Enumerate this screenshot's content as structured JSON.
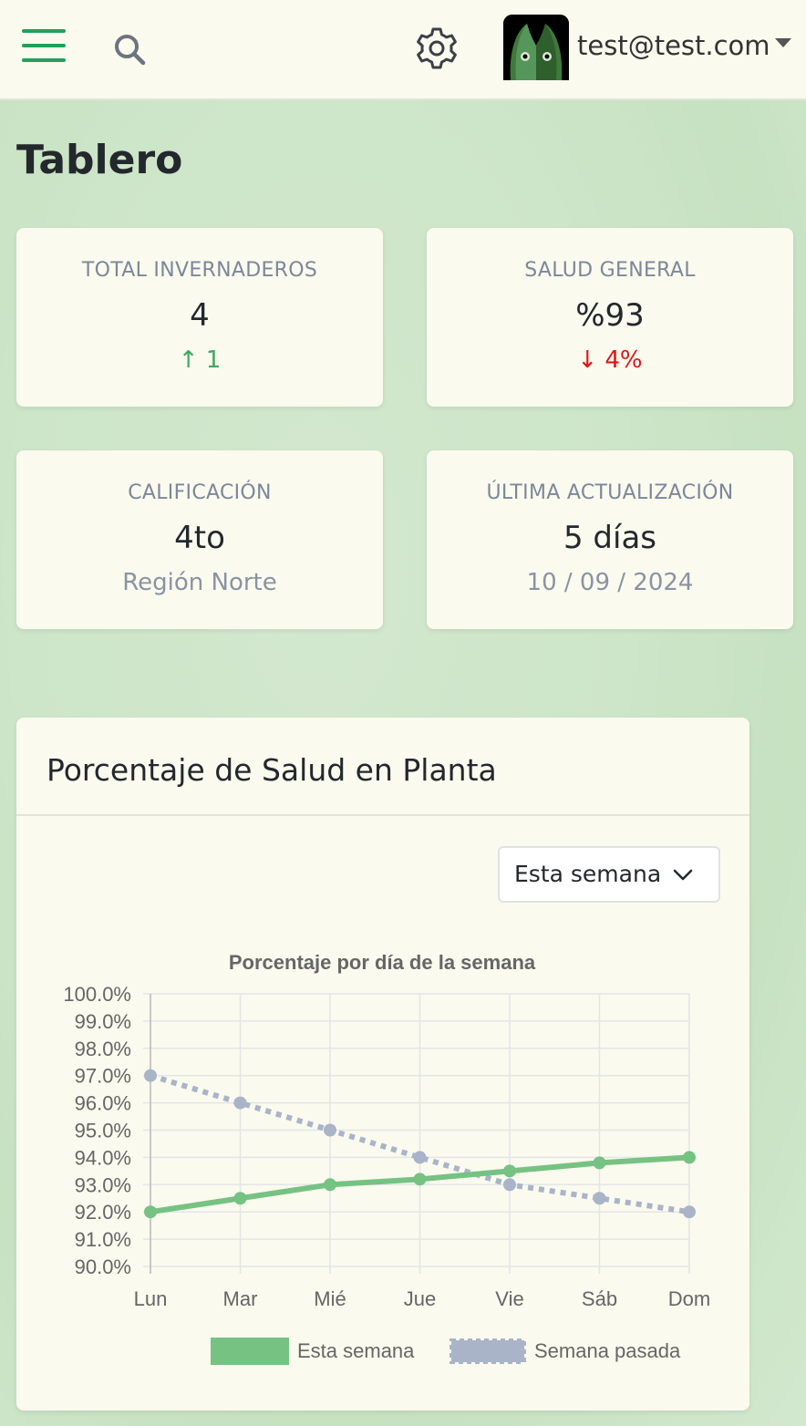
{
  "header": {
    "user_email": "test@test.com"
  },
  "page": {
    "title": "Tablero"
  },
  "stats": [
    {
      "label": "TOTAL INVERNADEROS",
      "value": "4",
      "sub": "↑ 1",
      "trend": "up"
    },
    {
      "label": "SALUD GENERAL",
      "value": "%93",
      "sub": "↓ 4%",
      "trend": "down"
    },
    {
      "label": "CALIFICACIÓN",
      "value": "4to",
      "sub": "Región Norte",
      "trend": "none"
    },
    {
      "label": "ÚLTIMA ACTUALIZACIÓN",
      "value": "5 días",
      "sub": "10 / 09 / 2024",
      "trend": "none"
    }
  ],
  "chart_card": {
    "title": "Porcentaje de Salud en Planta",
    "period_select": "Esta semana"
  },
  "colors": {
    "accent": "#22a05a",
    "this_week": "#76c283",
    "last_week": "#a9b4c9",
    "trend_up": "#3fa85d",
    "trend_down": "#e01515"
  },
  "chart_data": {
    "type": "line",
    "title": "Porcentaje por día de la semana",
    "categories": [
      "Lun",
      "Mar",
      "Mié",
      "Jue",
      "Vie",
      "Sáb",
      "Dom"
    ],
    "series": [
      {
        "name": "Esta semana",
        "values": [
          92.0,
          92.5,
          93.0,
          93.2,
          93.5,
          93.8,
          94.0
        ],
        "color": "#76c283",
        "style": "solid"
      },
      {
        "name": "Semana pasada",
        "values": [
          97.0,
          96.0,
          95.0,
          94.0,
          93.0,
          92.5,
          92.0
        ],
        "color": "#a9b4c9",
        "style": "dotted"
      }
    ],
    "ylim": [
      90,
      100
    ],
    "yticks": [
      "100.0%",
      "99.0%",
      "98.0%",
      "97.0%",
      "96.0%",
      "95.0%",
      "94.0%",
      "93.0%",
      "92.0%",
      "91.0%",
      "90.0%"
    ],
    "grid": true,
    "legend": "bottom"
  }
}
